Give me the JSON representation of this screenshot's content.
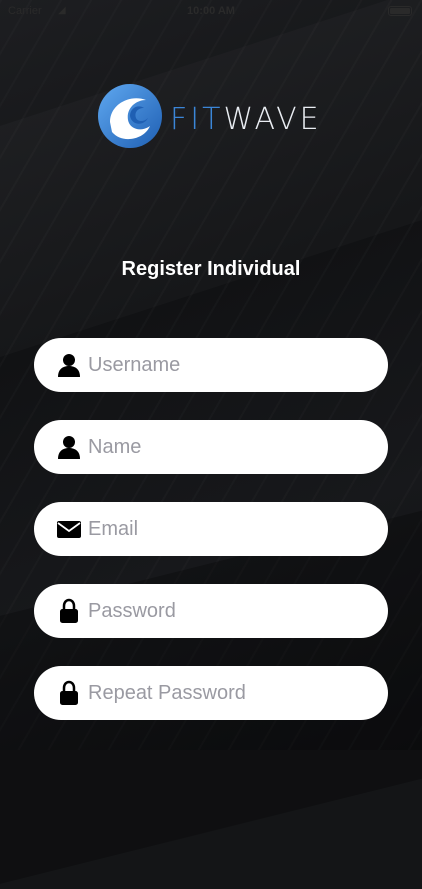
{
  "status_bar": {
    "carrier": "Carrier",
    "time": "10:00 AM"
  },
  "logo": {
    "word_part1": "FIT",
    "word_part2": "WAVE",
    "icon": "wave-logo-icon",
    "colors": {
      "fit": "#3b86d8",
      "wave": "#e9edf2"
    }
  },
  "page": {
    "title": "Register Individual"
  },
  "form": {
    "fields": [
      {
        "placeholder": "Username",
        "icon": "person-icon"
      },
      {
        "placeholder": "Name",
        "icon": "person-icon"
      },
      {
        "placeholder": "Email",
        "icon": "envelope-icon"
      },
      {
        "placeholder": "Password",
        "icon": "lock-icon"
      },
      {
        "placeholder": "Repeat Password",
        "icon": "lock-icon"
      }
    ]
  },
  "colors": {
    "background": "#141517",
    "field_bg": "#ffffff",
    "placeholder": "#9a9aa2",
    "title": "#ffffff"
  }
}
